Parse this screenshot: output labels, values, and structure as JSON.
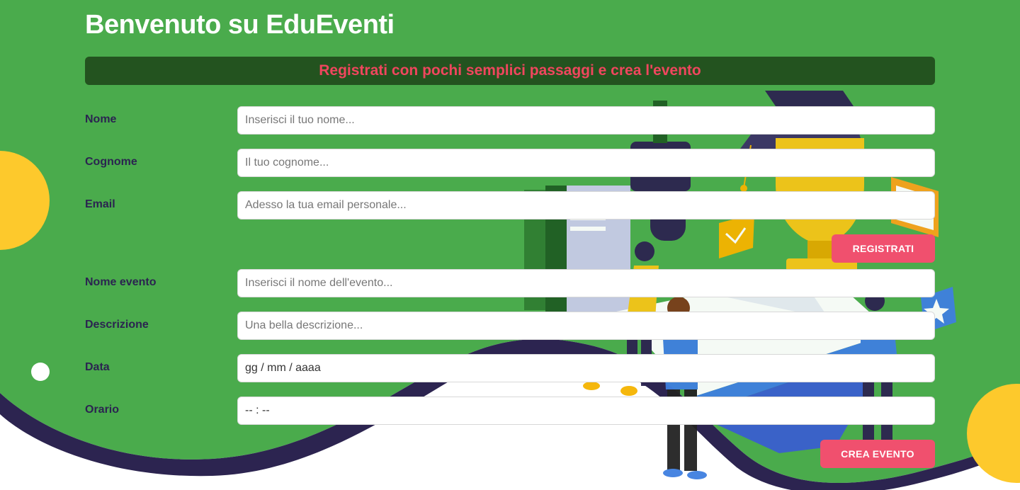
{
  "header": {
    "title": "Benvenuto su EduEventi"
  },
  "banner": {
    "text": "Registrati con pochi semplici passaggi e crea l'evento"
  },
  "registration": {
    "fields": [
      {
        "label": "Nome",
        "placeholder": "Inserisci il tuo nome..."
      },
      {
        "label": "Cognome",
        "placeholder": "Il tuo cognome..."
      },
      {
        "label": "Email",
        "placeholder": "Adesso la tua email personale..."
      }
    ],
    "submit_label": "REGISTRATI"
  },
  "event": {
    "fields": [
      {
        "label": "Nome evento",
        "placeholder": "Inserisci il nome dell'evento..."
      },
      {
        "label": "Descrizione",
        "placeholder": "Una bella descrizione..."
      },
      {
        "label": "Data",
        "value": "gg / mm / aaaa"
      },
      {
        "label": "Orario",
        "value": "-- : --"
      }
    ],
    "submit_label": "CREA EVENTO"
  },
  "colors": {
    "background_green": "#4aab4c",
    "banner_bg": "#23531f",
    "banner_text": "#f0465e",
    "accent_button": "#f0506e",
    "label_text": "#2b2450",
    "wave_dark": "#2c2450",
    "circle_yellow": "#fdc92c"
  },
  "illustration": {
    "icon": "education-graduation-illustration"
  }
}
